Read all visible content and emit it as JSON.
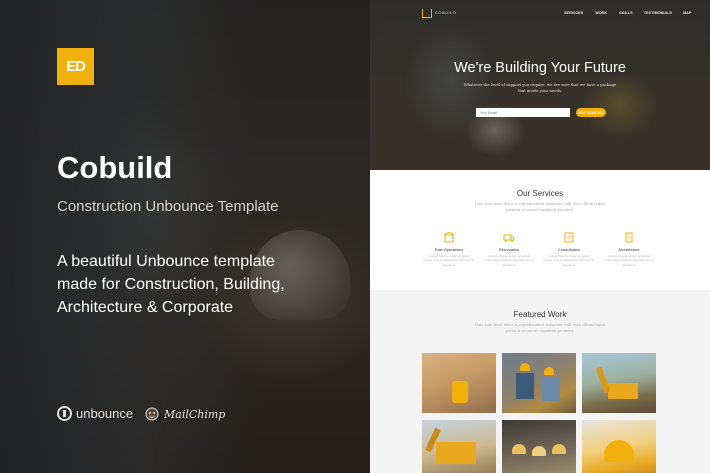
{
  "promo": {
    "badge": "ED",
    "title": "Cobuild",
    "subtitle": "Construction Unbounce Template",
    "description_lines": [
      "A beautiful Unbounce template",
      "made for Construction, Building,",
      "Architecture & Corporate"
    ],
    "partners": {
      "unbounce": "unbounce",
      "mailchimp": "MailChimp"
    },
    "colors": {
      "accent": "#f2b00c"
    }
  },
  "preview": {
    "nav": {
      "logo_text": "COBUILD",
      "links": [
        "SERVICES",
        "WORK",
        "SKILLS",
        "TESTIMONIALS",
        "MAP"
      ]
    },
    "hero": {
      "title": "We're Building Your Future",
      "subtitle": "Whatever the level of support you require, we are sure that we have a package that meets your needs.",
      "input_placeholder": "Your Email",
      "button_label": "GET STARTED"
    },
    "services": {
      "title": "Our Services",
      "description": "Duis aute irure dolor in reprehenderit voluptate velit esse cillum fugiat pariatur occaecat cupidatat proident.",
      "items": [
        {
          "name": "Past Operations",
          "text": "Lorem ipsum dolor sit amet consectetur adipiscing elit sed do eiusmod"
        },
        {
          "name": "Renovation",
          "text": "Lorem ipsum dolor sit amet consectetur adipiscing elit sed do eiusmod"
        },
        {
          "name": "Consultation",
          "text": "Lorem ipsum dolor sit amet consectetur adipiscing elit sed do eiusmod"
        },
        {
          "name": "Architecture",
          "text": "Lorem ipsum dolor sit amet consectetur adipiscing elit sed do eiusmod"
        }
      ]
    },
    "featured": {
      "title": "Featured Work",
      "description": "Duis aute irure dolor in reprehenderit voluptate velit esse cillum fugiat pariatur occaecat cupidatat proident."
    }
  }
}
